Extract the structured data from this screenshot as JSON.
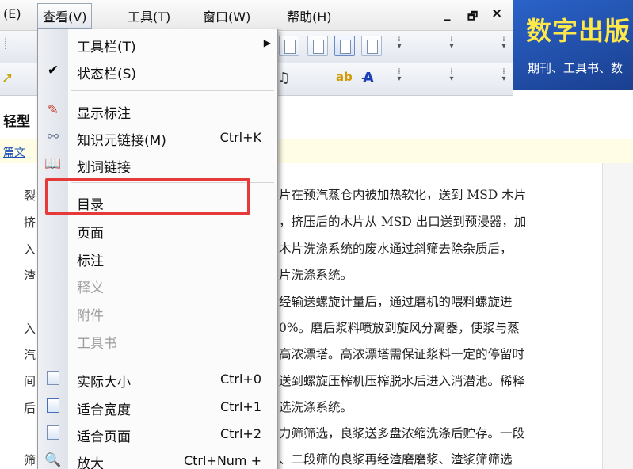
{
  "menubar": {
    "items": [
      {
        "label": "(E)"
      },
      {
        "label": "查看(V)"
      },
      {
        "label": "工具(T)"
      },
      {
        "label": "窗口(W)"
      },
      {
        "label": "帮助(H)"
      }
    ],
    "minimize": "_",
    "restore": "🗗",
    "close": "×"
  },
  "brand": {
    "title": "数字出版",
    "subtitle": "期刊、工具书、数"
  },
  "document": {
    "title_fragment": "轻型",
    "tab_fragment": "篇文",
    "left_chars": [
      "裂",
      "挤",
      "入",
      "渣",
      "入",
      "汽",
      "间",
      "后",
      "筛"
    ],
    "lines": [
      "片在预汽蒸仓内被加热软化，送到 MSD 木片",
      "，挤压后的木片从 MSD 出口送到预浸器，加",
      "木片洗涤系统的废水通过斜筛去除杂质后，",
      "片洗涤系统。",
      "经输送螺旋计量后，通过磨机的喂料螺旋进",
      "0%。磨后浆料喷放到旋风分离器，使浆与蒸",
      "高浓漂塔。高浓漂塔需保证浆料一定的停留时",
      "送到螺旋压榨机压榨脱水后进入消潜池。稀释",
      "选洗涤系统。",
      "力筛筛选，良浆送多盘浓缩洗涤后贮存。一段",
      "、二段筛的良浆再经渣磨磨浆、渣浆筛筛选"
    ]
  },
  "view_menu": {
    "items": [
      {
        "label": "工具栏(T)",
        "shortcut": "",
        "icon": "none",
        "submenu": true,
        "disabled": false
      },
      {
        "label": "状态栏(S)",
        "shortcut": "",
        "icon": "check-icon",
        "submenu": false,
        "disabled": false
      },
      {
        "label": "显示标注",
        "shortcut": "",
        "icon": "annotation-icon",
        "submenu": false,
        "disabled": false
      },
      {
        "label": "知识元链接(M)",
        "shortcut": "Ctrl+K",
        "icon": "knowledge-link-icon",
        "submenu": false,
        "disabled": false
      },
      {
        "label": "划词链接",
        "shortcut": "",
        "icon": "book-icon",
        "submenu": false,
        "disabled": false
      },
      {
        "label": "目录",
        "shortcut": "",
        "icon": "none",
        "submenu": false,
        "disabled": false
      },
      {
        "label": "页面",
        "shortcut": "",
        "icon": "none",
        "submenu": false,
        "disabled": false
      },
      {
        "label": "标注",
        "shortcut": "",
        "icon": "none",
        "submenu": false,
        "disabled": false
      },
      {
        "label": "释义",
        "shortcut": "",
        "icon": "none",
        "submenu": false,
        "disabled": true
      },
      {
        "label": "附件",
        "shortcut": "",
        "icon": "none",
        "submenu": false,
        "disabled": true
      },
      {
        "label": "工具书",
        "shortcut": "",
        "icon": "none",
        "submenu": false,
        "disabled": true
      },
      {
        "label": "实际大小",
        "shortcut": "Ctrl+0",
        "icon": "page-actual-icon",
        "submenu": false,
        "disabled": false
      },
      {
        "label": "适合宽度",
        "shortcut": "Ctrl+1",
        "icon": "page-fit-width-icon",
        "submenu": false,
        "disabled": false
      },
      {
        "label": "适合页面",
        "shortcut": "Ctrl+2",
        "icon": "page-fit-page-icon",
        "submenu": false,
        "disabled": false
      },
      {
        "label": "放大",
        "shortcut": "Ctrl+Num +",
        "icon": "zoom-in-icon",
        "submenu": false,
        "disabled": false
      }
    ],
    "highlight_color": "#e63a3a"
  }
}
